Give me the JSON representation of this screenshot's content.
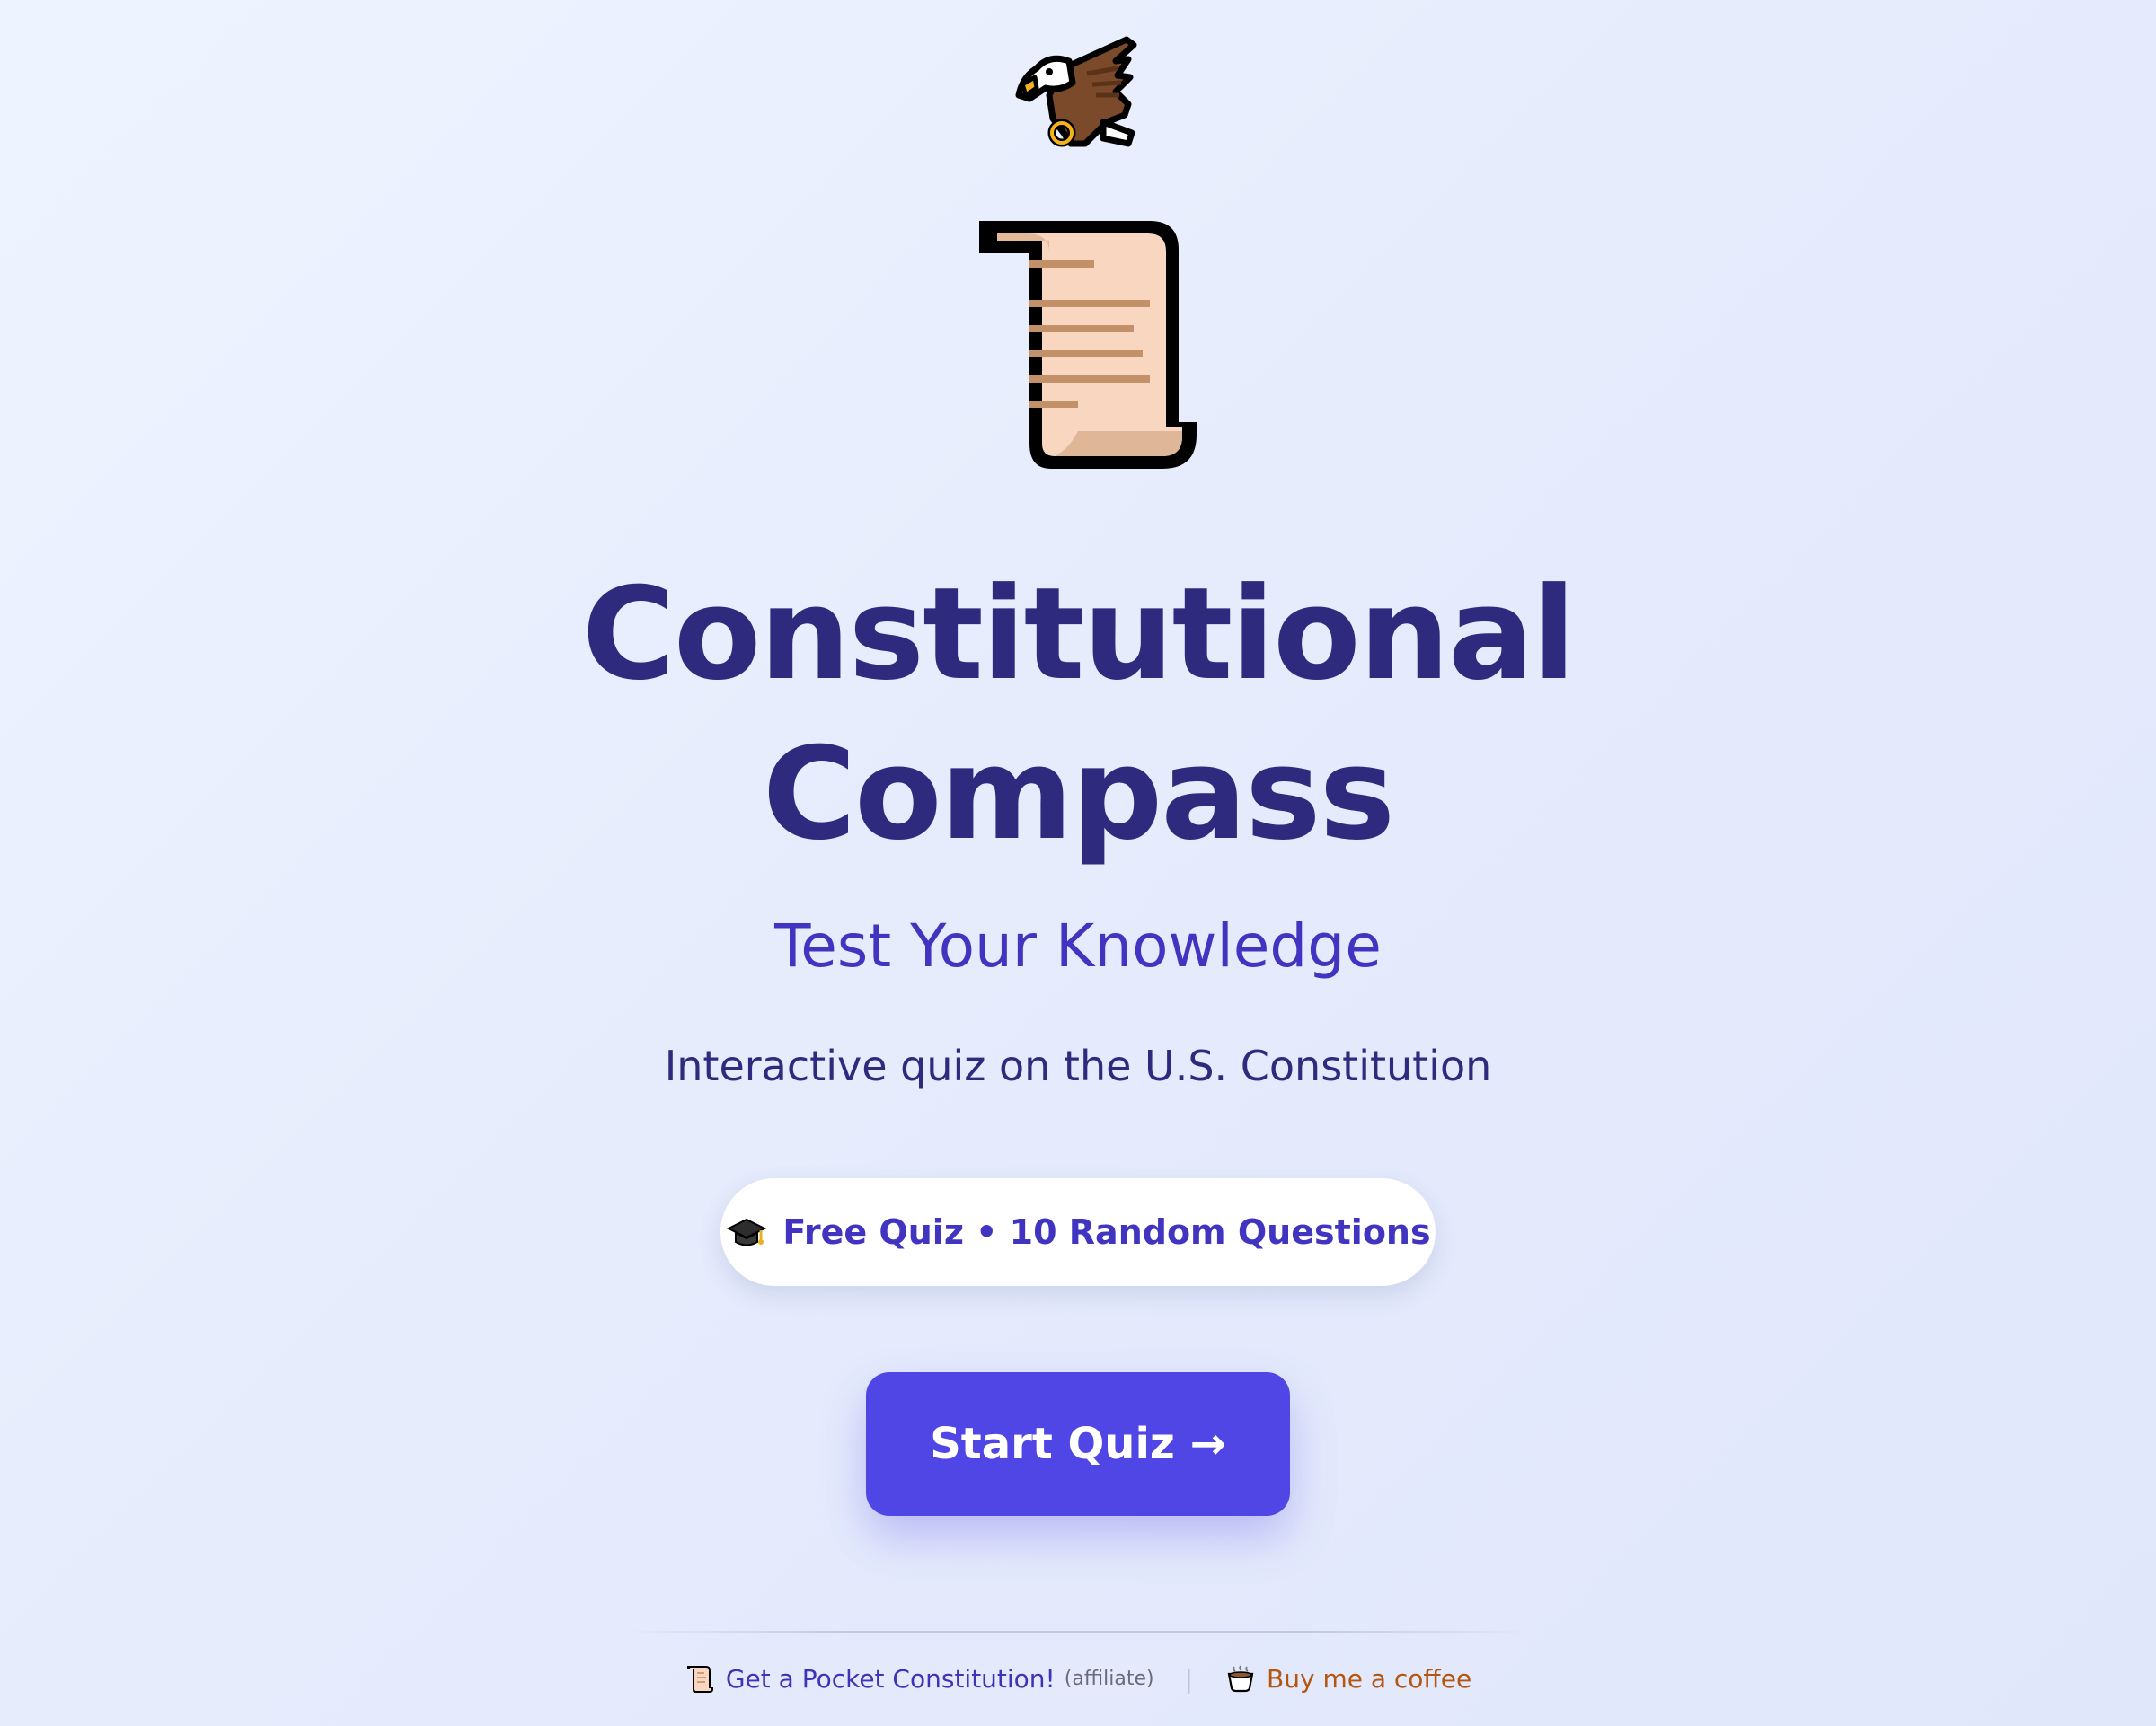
{
  "hero": {
    "eagle_icon": "eagle-icon",
    "scroll_icon": "scroll-icon",
    "title_line1": "Constitutional",
    "title_line2": "Compass",
    "subtitle": "Test Your Knowledge",
    "tagline": "Interactive quiz on the U.S. Constitution"
  },
  "badge": {
    "icon": "graduation-cap-icon",
    "label": "Free Quiz • 10 Random Questions"
  },
  "cta": {
    "label": "Start Quiz →",
    "color": "#4f46e5"
  },
  "footer": {
    "pocket_link": {
      "icon": "scroll-icon",
      "label": "Get a Pocket Constitution!",
      "note": "(affiliate)"
    },
    "separator": "|",
    "coffee_link": {
      "icon": "coffee-cup-icon",
      "label": "Buy me a coffee"
    }
  },
  "colors": {
    "title": "#2e2a7d",
    "accent": "#4034c0",
    "coffee": "#b4560f"
  }
}
